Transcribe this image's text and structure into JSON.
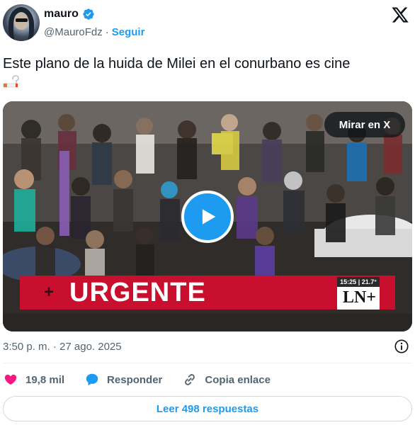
{
  "author": {
    "display_name": "mauro",
    "handle": "@MauroFdz",
    "separator": "·",
    "follow_label": "Seguir"
  },
  "tweet": {
    "text": "Este plano de la huida de Milei en el conurbano es cine",
    "emoji": "smoking-question-emoji"
  },
  "media": {
    "view_on_x_label": "Mirar en X",
    "banner_text": "URGENTE",
    "banner_plus": "+",
    "channel_time": "15:25 | 21.7°",
    "channel_logo": "LN+"
  },
  "meta": {
    "timestamp": "3:50 p. m. · 27 ago. 2025"
  },
  "actions": {
    "likes": "19,8 mil",
    "reply_label": "Responder",
    "copy_link_label": "Copia enlace"
  },
  "read_replies_label": "Leer 498 respuestas",
  "colors": {
    "accent": "#1d9bf0",
    "like": "#f91880",
    "banner": "#c8102e",
    "text_secondary": "#536471"
  }
}
